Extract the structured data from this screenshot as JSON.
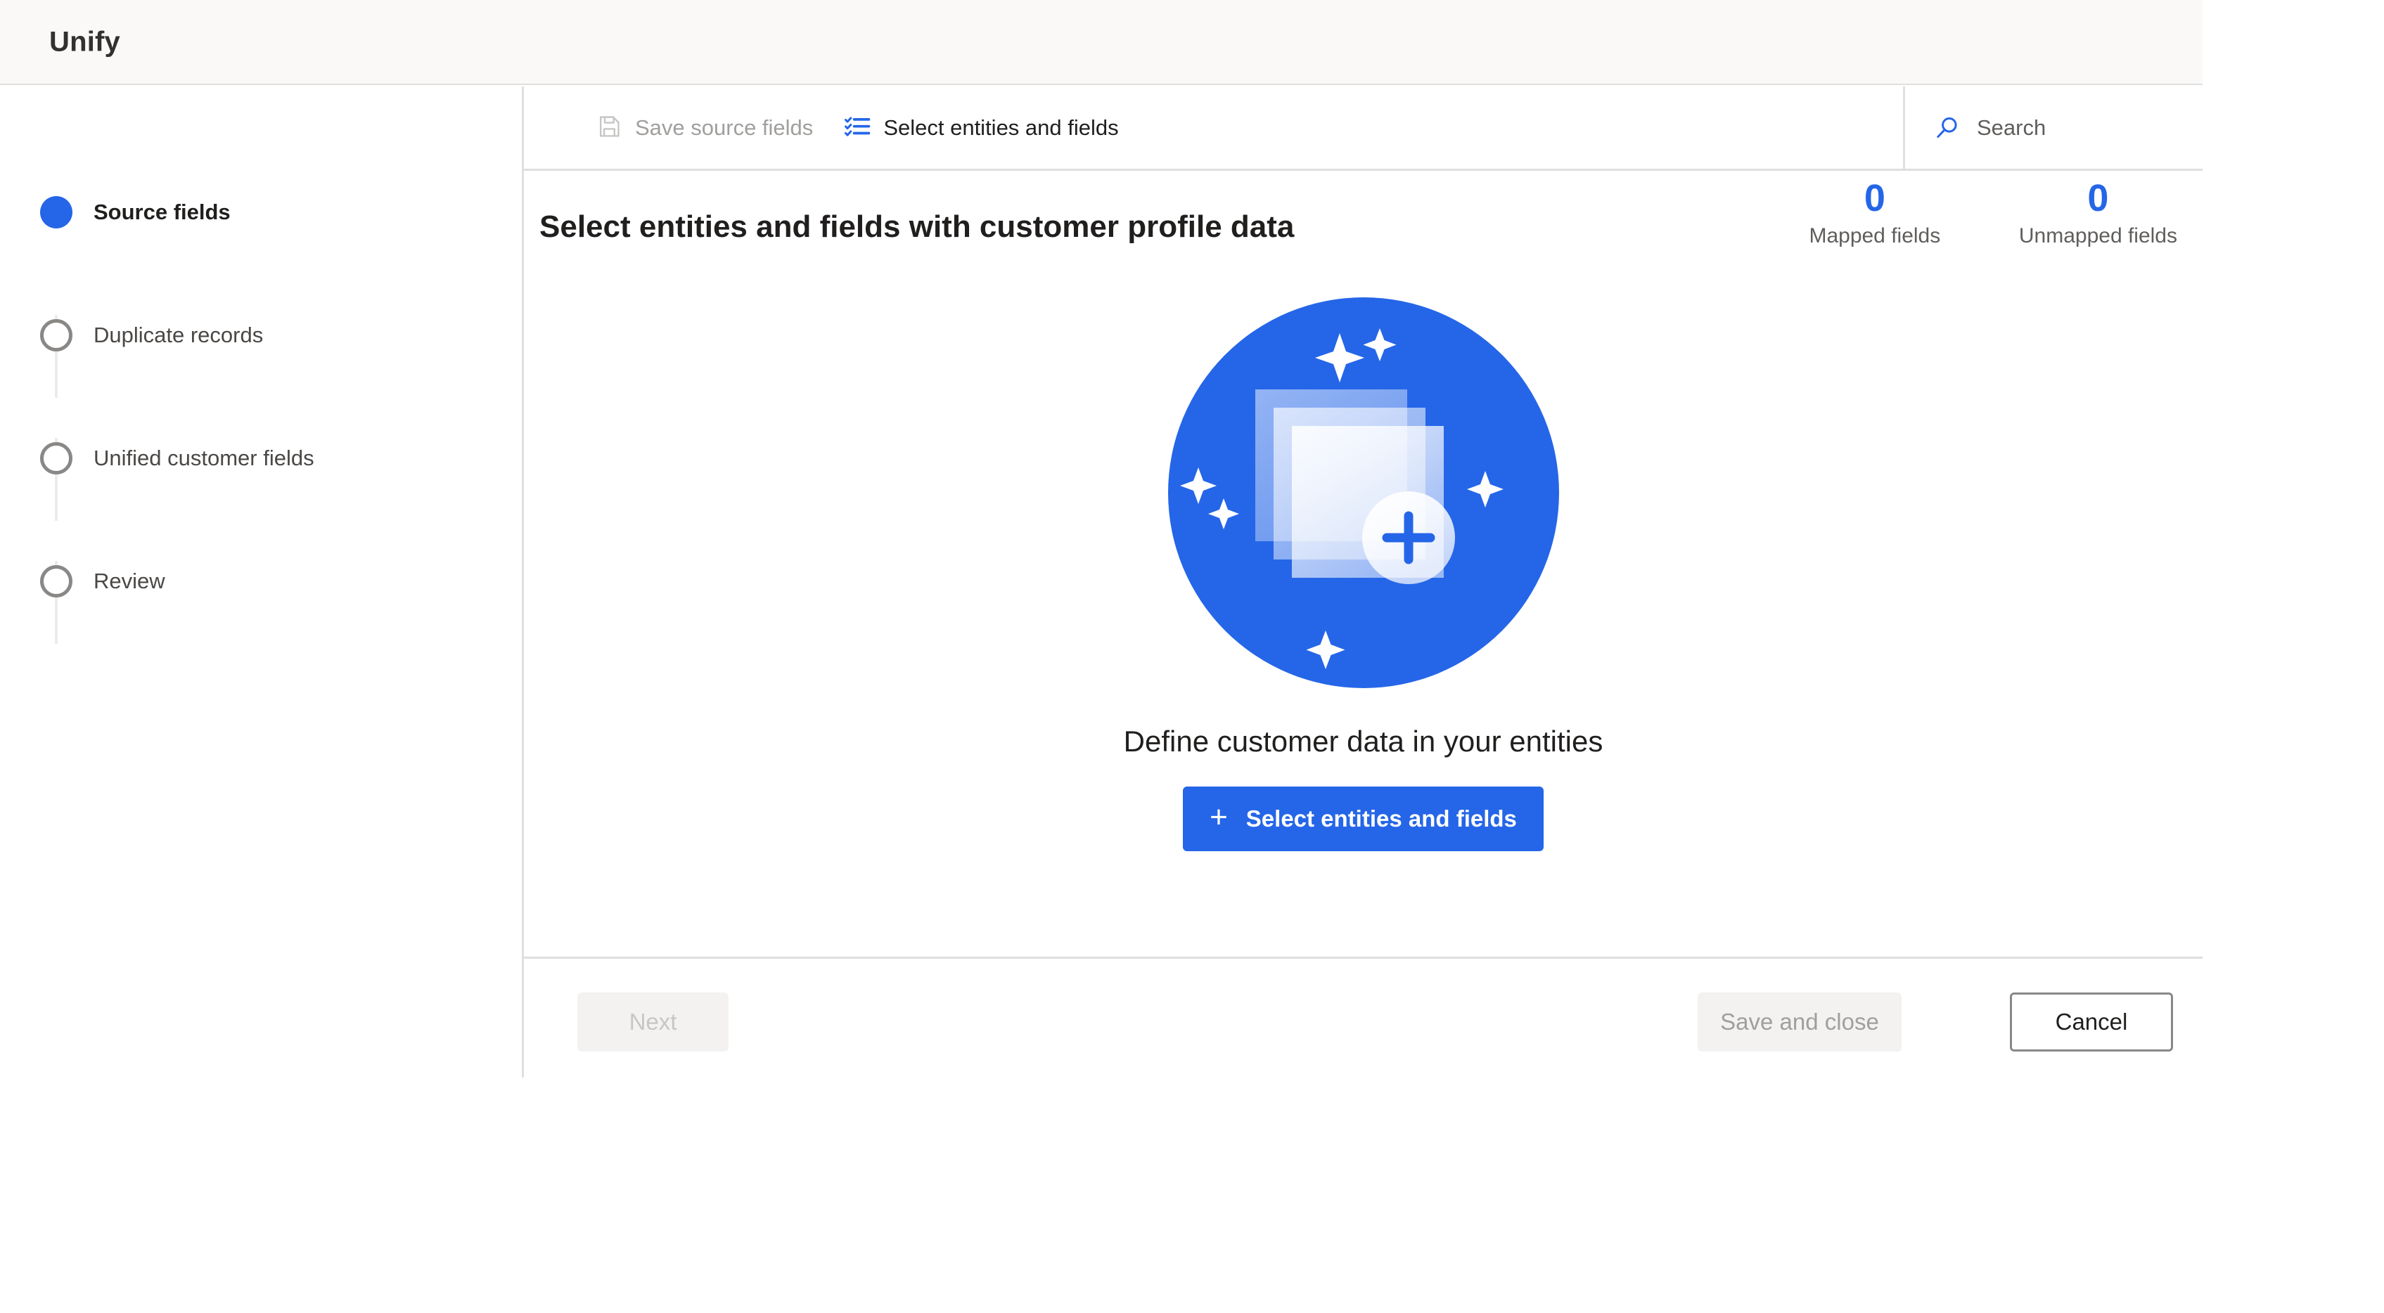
{
  "app": {
    "title": "Unify"
  },
  "wizard": {
    "steps": [
      {
        "label": "Source fields",
        "state": "active",
        "marker": "step-dot-filled"
      },
      {
        "label": "Duplicate records",
        "state": "inactive",
        "marker": "step-dot-outline"
      },
      {
        "label": "Unified customer fields",
        "state": "inactive",
        "marker": "step-dot-outline"
      },
      {
        "label": "Review",
        "state": "inactive",
        "marker": "step-dot-outline"
      }
    ]
  },
  "command_bar": {
    "save_source_fields": {
      "label": "Save source fields",
      "icon": "save-icon",
      "enabled": false
    },
    "select_entities_and_fields": {
      "label": "Select entities and fields",
      "icon": "checklist-icon",
      "enabled": true
    },
    "search": {
      "placeholder": "Search",
      "icon": "search-icon",
      "value": ""
    }
  },
  "content": {
    "page_title": "Select entities and fields with customer profile data",
    "counters": [
      {
        "value": "0",
        "label": "Mapped fields"
      },
      {
        "value": "0",
        "label": "Unmapped fields"
      }
    ],
    "empty_state": {
      "illustration": "stacked-documents-add-illustration",
      "heading": "Define customer data in your entities",
      "cta_label": "Select entities and fields",
      "cta_icon": "plus-icon"
    }
  },
  "footer": {
    "next_label": "Next",
    "save_and_close_label": "Save and close",
    "cancel_label": "Cancel"
  },
  "colors": {
    "accent": "#2566e8",
    "header_bg": "#faf9f8",
    "border": "#e1dfdd",
    "disabled_bg": "#f3f2f1",
    "disabled_text": "#a19f9d",
    "muted_text": "#605e5c"
  }
}
